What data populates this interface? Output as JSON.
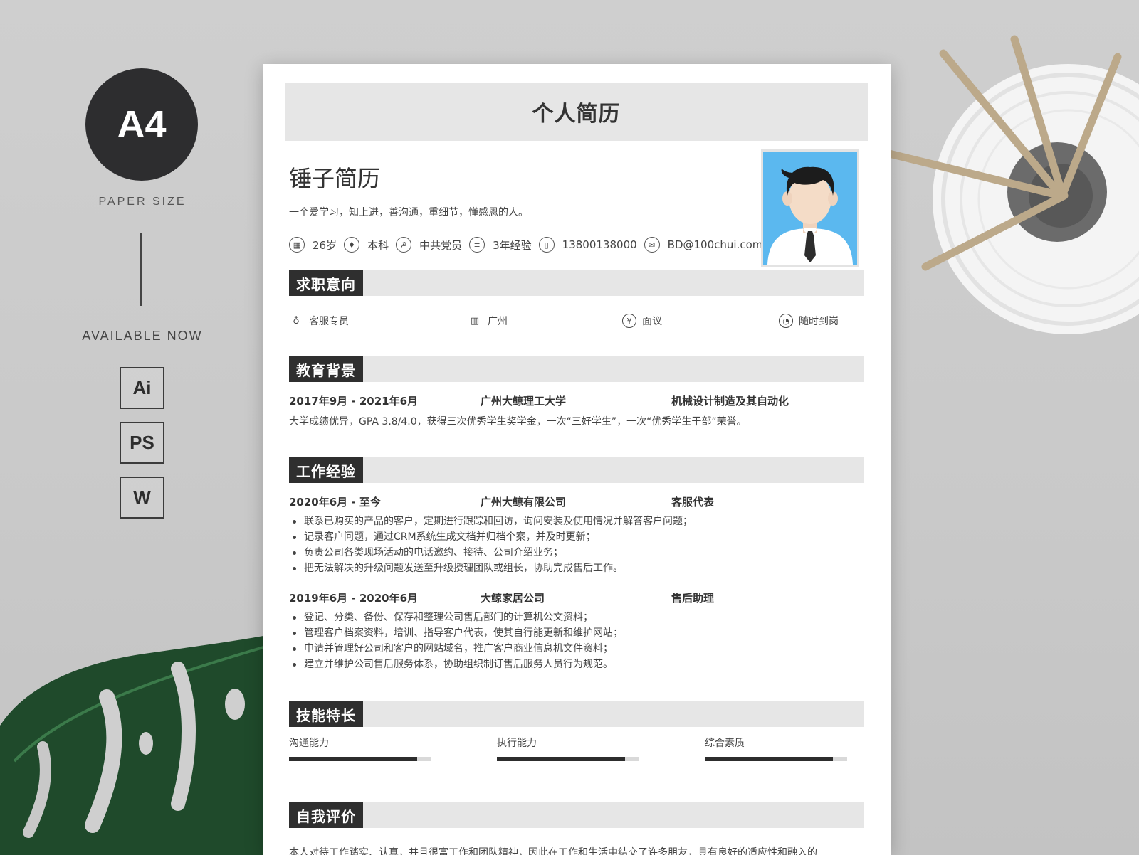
{
  "promo": {
    "badge": "A4",
    "paper_size": "PAPER SIZE",
    "available": "AVAILABLE NOW",
    "formats": [
      "Ai",
      "PS",
      "W"
    ]
  },
  "resume": {
    "doc_title": "个人简历",
    "name": "锤子简历",
    "motto": "一个爱学习，知上进，善沟通，重细节，懂感恩的人。",
    "info": [
      {
        "icon": "calendar-icon",
        "text": "26岁"
      },
      {
        "icon": "graduation-cap-icon",
        "text": "本科"
      },
      {
        "icon": "party-emblem-icon",
        "text": "中共党员"
      },
      {
        "icon": "document-icon",
        "text": "3年经验"
      },
      {
        "icon": "phone-icon",
        "text": "13800138000"
      },
      {
        "icon": "mail-icon",
        "text": "BD@100chui.com"
      }
    ],
    "sections": {
      "intent": "求职意向",
      "education": "教育背景",
      "work": "工作经验",
      "skills": "技能特长",
      "self_eval": "自我评价"
    },
    "intent": [
      {
        "icon": "tie-icon",
        "text": "客服专员"
      },
      {
        "icon": "building-icon",
        "text": "广州"
      },
      {
        "icon": "yen-icon",
        "text": "面议"
      },
      {
        "icon": "clock-icon",
        "text": "随时到岗"
      }
    ],
    "education": {
      "period": "2017年9月 - 2021年6月",
      "school": "广州大鲸理工大学",
      "major": "机械设计制造及其自动化",
      "detail": "大学成绩优异，GPA 3.8/4.0，获得三次优秀学生奖学金，一次“三好学生”，一次“优秀学生干部”荣誉。"
    },
    "work": [
      {
        "period": "2020年6月 - 至今",
        "company": "广州大鲸有限公司",
        "role": "客服代表",
        "duties": [
          "联系已购买的产品的客户，定期进行跟踪和回访，询问安装及使用情况并解答客户问题；",
          "记录客户问题，通过CRM系统生成文档并归档个案，并及时更新；",
          "负责公司各类现场活动的电话邀约、接待、公司介绍业务；",
          "把无法解决的升级问题发送至升级授理团队或组长，协助完成售后工作。"
        ]
      },
      {
        "period": "2019年6月 - 2020年6月",
        "company": "大鲸家居公司",
        "role": "售后助理",
        "duties": [
          "登记、分类、备份、保存和整理公司售后部门的计算机公文资料；",
          "管理客户档案资料，培训、指导客户代表，使其自行能更新和维护网站；",
          "申请并管理好公司和客户的网站域名，推广客户商业信息机文件资料；",
          "建立并维护公司售后服务体系，协助组织制订售后服务人员行为规范。"
        ]
      }
    ],
    "skills": [
      {
        "label": "沟通能力",
        "level": 0.9
      },
      {
        "label": "执行能力",
        "level": 0.9
      },
      {
        "label": "综合素质",
        "level": 0.9
      }
    ],
    "self_eval_partial": "本人对待工作踏实、认真，并且很富工作和团队精神，因此在工作和生活中结交了许多朋友，具有良好的适应性和融入的"
  }
}
